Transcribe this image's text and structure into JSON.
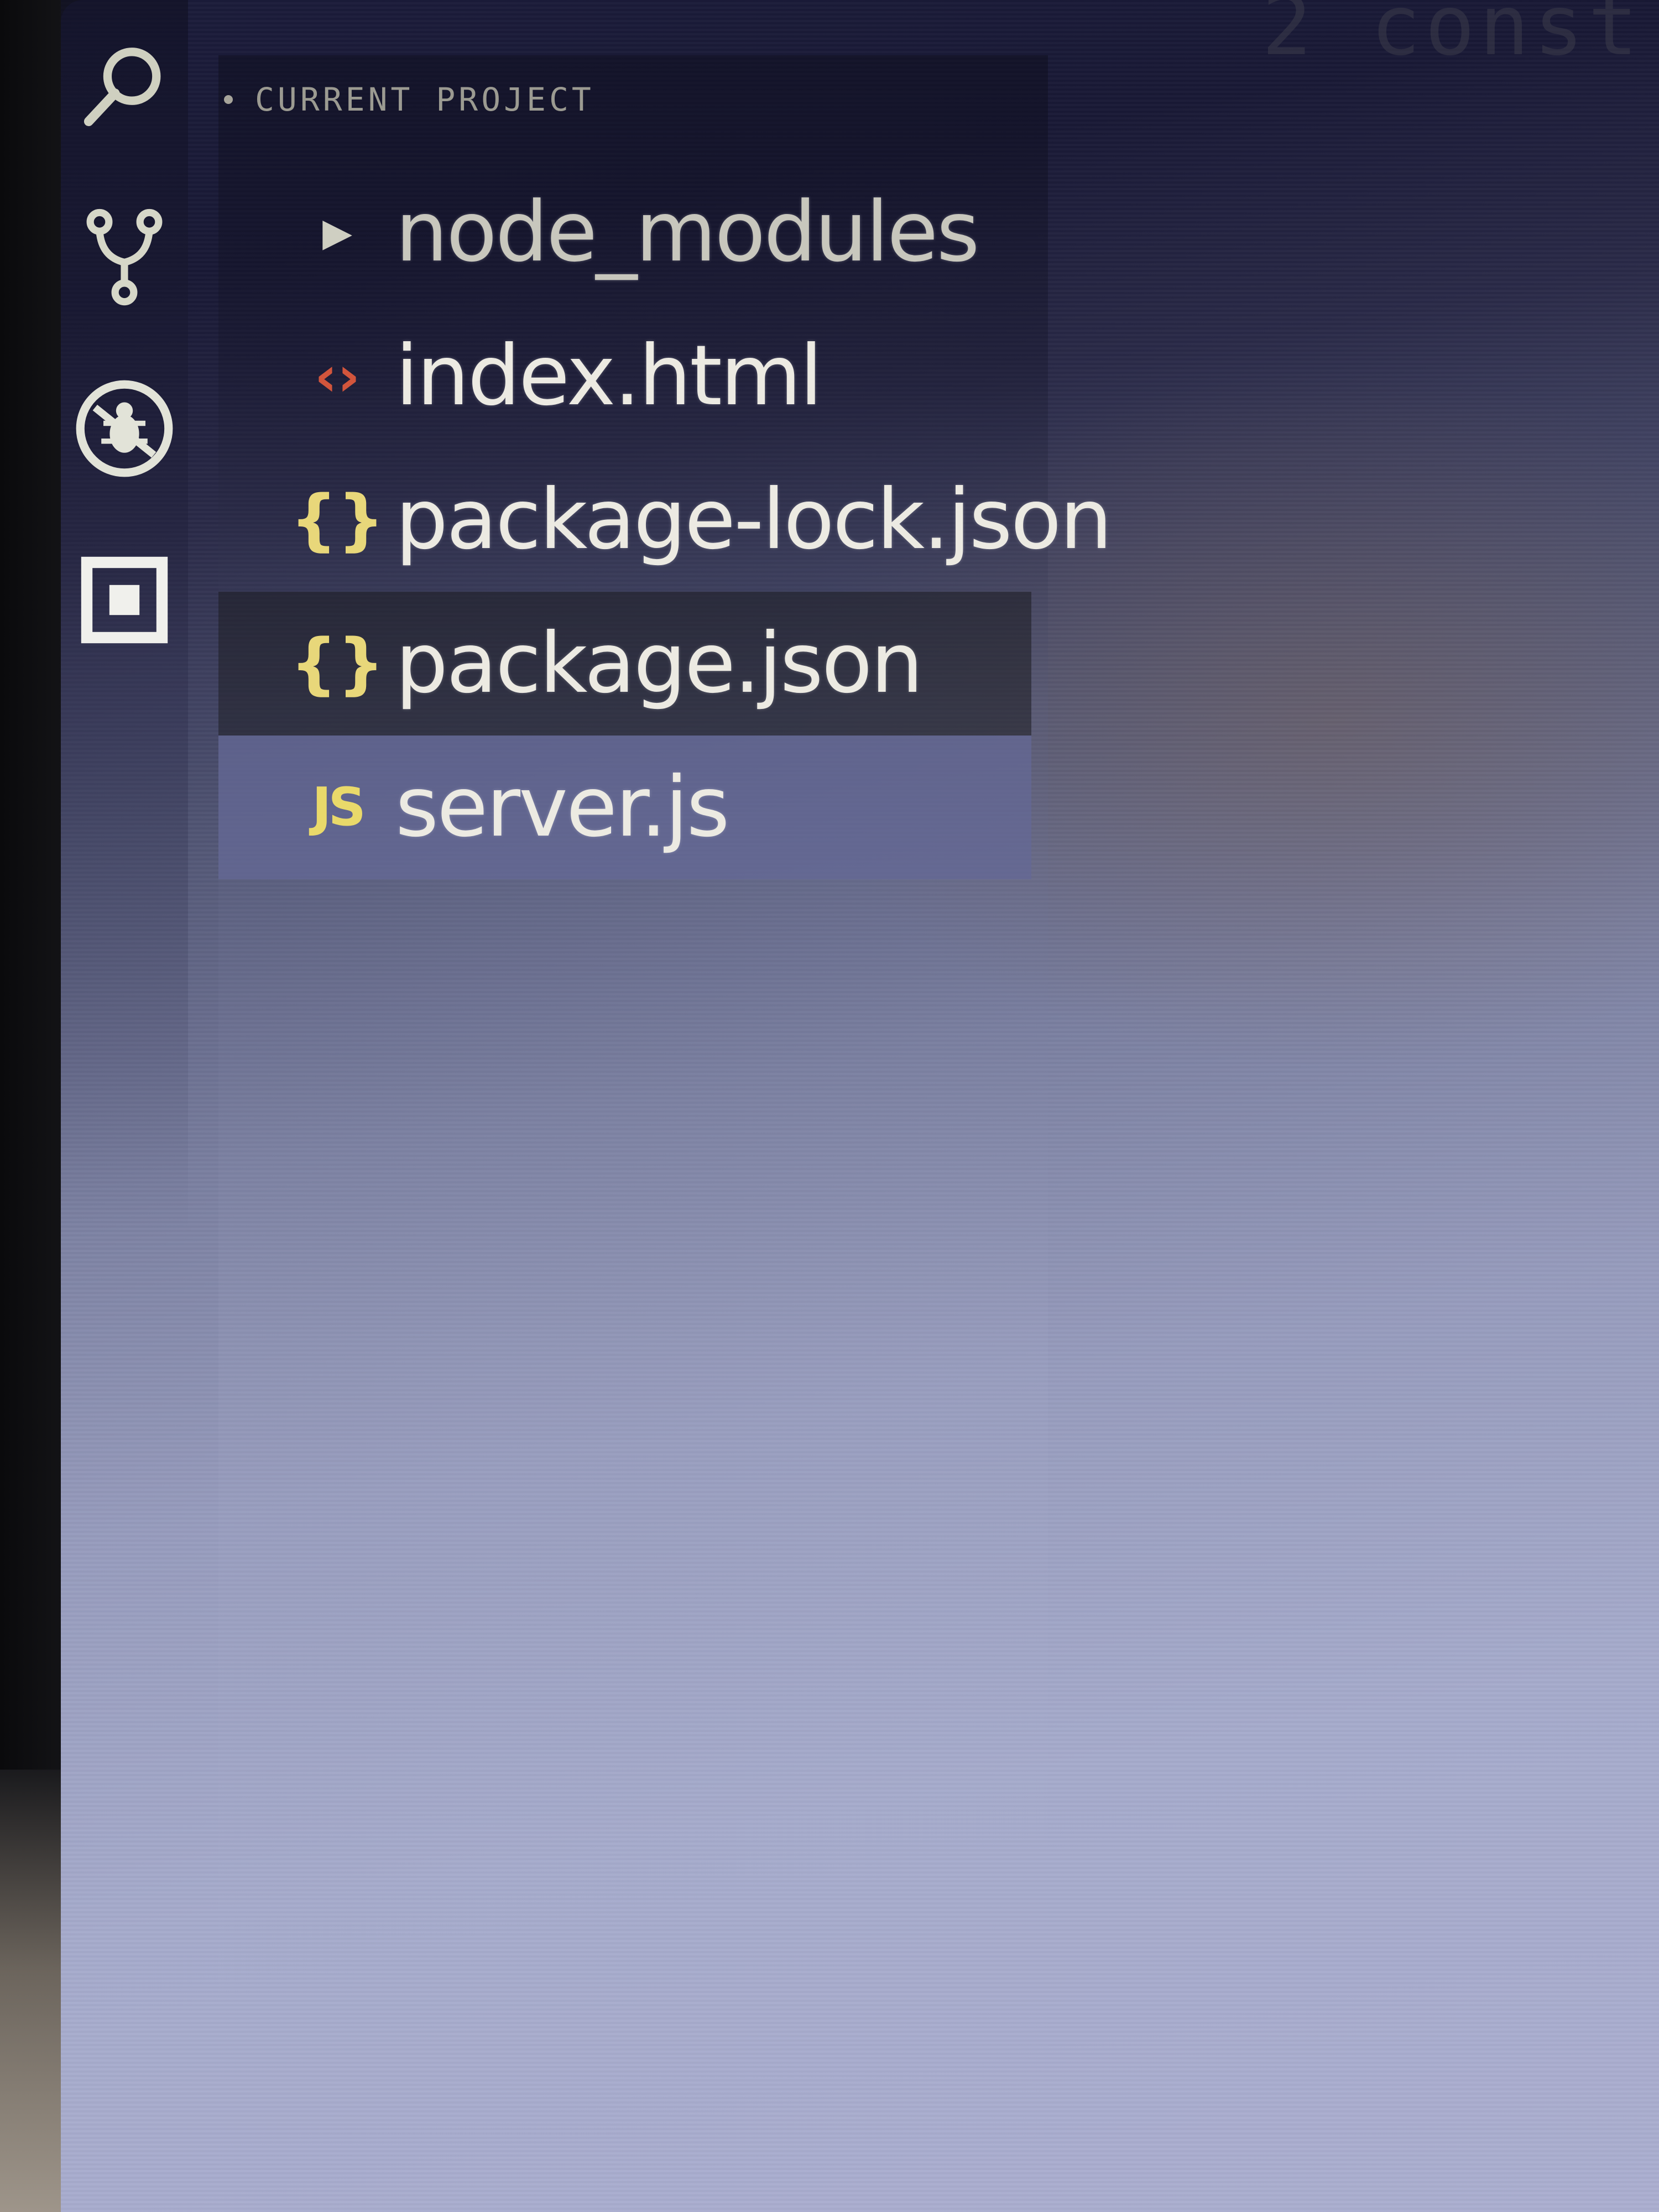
{
  "activity_bar": {
    "icons": [
      {
        "name": "search-icon"
      },
      {
        "name": "source-control-icon"
      },
      {
        "name": "debug-icon"
      },
      {
        "name": "extensions-icon"
      }
    ]
  },
  "explorer": {
    "section_title": "CURRENT PROJECT",
    "items": [
      {
        "label": "node_modules",
        "type": "folder",
        "icon": "chevron-right-icon"
      },
      {
        "label": "index.html",
        "type": "file",
        "icon": "html-file-icon",
        "icon_glyph": "‹›"
      },
      {
        "label": "package-lock.json",
        "type": "file",
        "icon": "json-file-icon",
        "icon_glyph": "{}"
      },
      {
        "label": "package.json",
        "type": "file",
        "icon": "json-file-icon",
        "icon_glyph": "{}"
      },
      {
        "label": "server.js",
        "type": "file",
        "icon": "js-file-icon",
        "icon_glyph": "JS",
        "selected": true
      }
    ]
  },
  "editor": {
    "peek_text": "2 const"
  },
  "colors": {
    "html_icon": "#d2553c",
    "json_icon": "#e8d77a",
    "js_icon": "#e9d96a",
    "selection": "#64689a"
  }
}
